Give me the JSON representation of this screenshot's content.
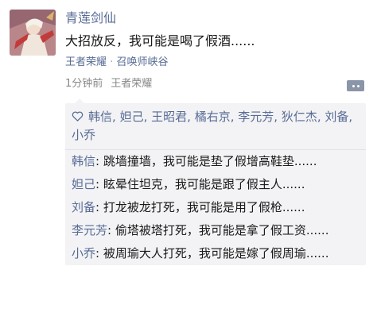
{
  "post": {
    "author": "青莲剑仙",
    "content": "大招放反，我可能是喝了假酒......",
    "source_app": "王者荣耀",
    "source_separator": "·",
    "source_detail": "召唤师峡谷",
    "time": "1分钟前",
    "time_app": "王者荣耀"
  },
  "likes": {
    "icon": "heart-outline-icon",
    "names": [
      "韩信",
      "妲己",
      "王昭君",
      "橘右京",
      "李元芳",
      "狄仁杰",
      "刘备",
      "小乔"
    ],
    "separator": ", "
  },
  "comments": [
    {
      "name": "韩信",
      "colon": ":",
      "text": " 跳墙撞墙，我可能是垫了假增高鞋垫......"
    },
    {
      "name": "妲己",
      "colon": ":",
      "text": " 眩晕住坦克，我可能是跟了假主人......"
    },
    {
      "name": "刘备",
      "colon": ":",
      "text": " 打龙被龙打死，我可能是用了假枪......"
    },
    {
      "name": "李元芳",
      "colon": ":",
      "text": " 偷塔被塔打死，我可能是拿了假工资......"
    },
    {
      "name": "小乔",
      "colon": ":",
      "text": " 被周瑜大人打死，我可能是嫁了假周瑜......"
    }
  ],
  "colors": {
    "name_link": "#576b95",
    "panel_bg": "#f3f3f5",
    "meta_gray": "#888888"
  }
}
